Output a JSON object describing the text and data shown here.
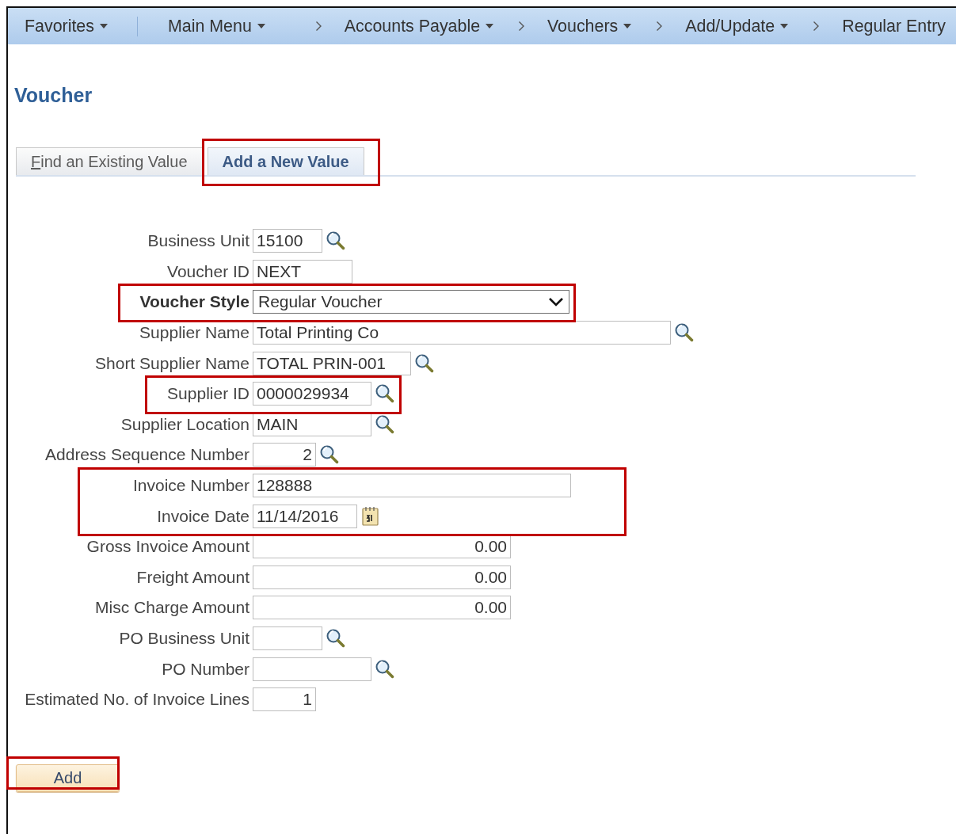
{
  "nav": [
    {
      "label": "Favorites",
      "dropdown": true,
      "chevron": false
    },
    {
      "label": "Main Menu",
      "dropdown": true,
      "chevron": false
    },
    {
      "label": "Accounts Payable",
      "dropdown": true,
      "chevron": true
    },
    {
      "label": "Vouchers",
      "dropdown": true,
      "chevron": true
    },
    {
      "label": "Add/Update",
      "dropdown": true,
      "chevron": true
    },
    {
      "label": "Regular Entry",
      "dropdown": false,
      "chevron": true
    }
  ],
  "page_title": "Voucher",
  "tabs": [
    {
      "label": "Find an Existing Value",
      "selected": false,
      "access_key_underlined": true,
      "highlighted": false
    },
    {
      "label": "Add a New Value",
      "selected": true,
      "access_key_underlined": false,
      "highlighted": true
    }
  ],
  "fields": [
    {
      "label": "Business Unit",
      "value": "15100",
      "kind": "text",
      "lookup": true,
      "required": false,
      "highlighted": false
    },
    {
      "label": "Voucher ID",
      "value": "NEXT",
      "kind": "text",
      "lookup": false,
      "required": false,
      "highlighted": false
    },
    {
      "label": "Voucher Style",
      "value": "Regular Voucher",
      "kind": "select",
      "lookup": false,
      "required": true,
      "highlighted": true
    },
    {
      "label": "Supplier Name",
      "value": "Total Printing Co",
      "kind": "text",
      "lookup": true,
      "required": false,
      "highlighted": false
    },
    {
      "label": "Short Supplier Name",
      "value": "TOTAL PRIN-001",
      "kind": "text",
      "lookup": true,
      "required": false,
      "highlighted": false
    },
    {
      "label": "Supplier ID",
      "value": "0000029934",
      "kind": "text",
      "lookup": true,
      "required": false,
      "highlighted": true
    },
    {
      "label": "Supplier Location",
      "value": "MAIN",
      "kind": "text",
      "lookup": true,
      "required": false,
      "highlighted": false
    },
    {
      "label": "Address Sequence Number",
      "value": "2",
      "kind": "number",
      "lookup": true,
      "required": false,
      "highlighted": false
    },
    {
      "label": "Invoice Number",
      "value": "128888",
      "kind": "text",
      "lookup": false,
      "required": false,
      "highlighted": true
    },
    {
      "label": "Invoice Date",
      "value": "11/14/2016",
      "kind": "date",
      "lookup": false,
      "required": false,
      "highlighted": true
    },
    {
      "label": "Gross Invoice Amount",
      "value": "0.00",
      "kind": "number",
      "lookup": false,
      "required": false,
      "highlighted": false
    },
    {
      "label": "Freight Amount",
      "value": "0.00",
      "kind": "number",
      "lookup": false,
      "required": false,
      "highlighted": false
    },
    {
      "label": "Misc Charge Amount",
      "value": "0.00",
      "kind": "number",
      "lookup": false,
      "required": false,
      "highlighted": false
    },
    {
      "label": "PO Business Unit",
      "kind": "text",
      "lookup": true,
      "required": false,
      "highlighted": false
    },
    {
      "label": "PO Number",
      "kind": "text",
      "lookup": true,
      "required": false,
      "highlighted": false
    },
    {
      "label": "Estimated No. of Invoice Lines",
      "value": "1",
      "kind": "number",
      "lookup": false,
      "required": false,
      "highlighted": false
    }
  ],
  "add_button": {
    "label": "Add",
    "highlighted": true
  }
}
